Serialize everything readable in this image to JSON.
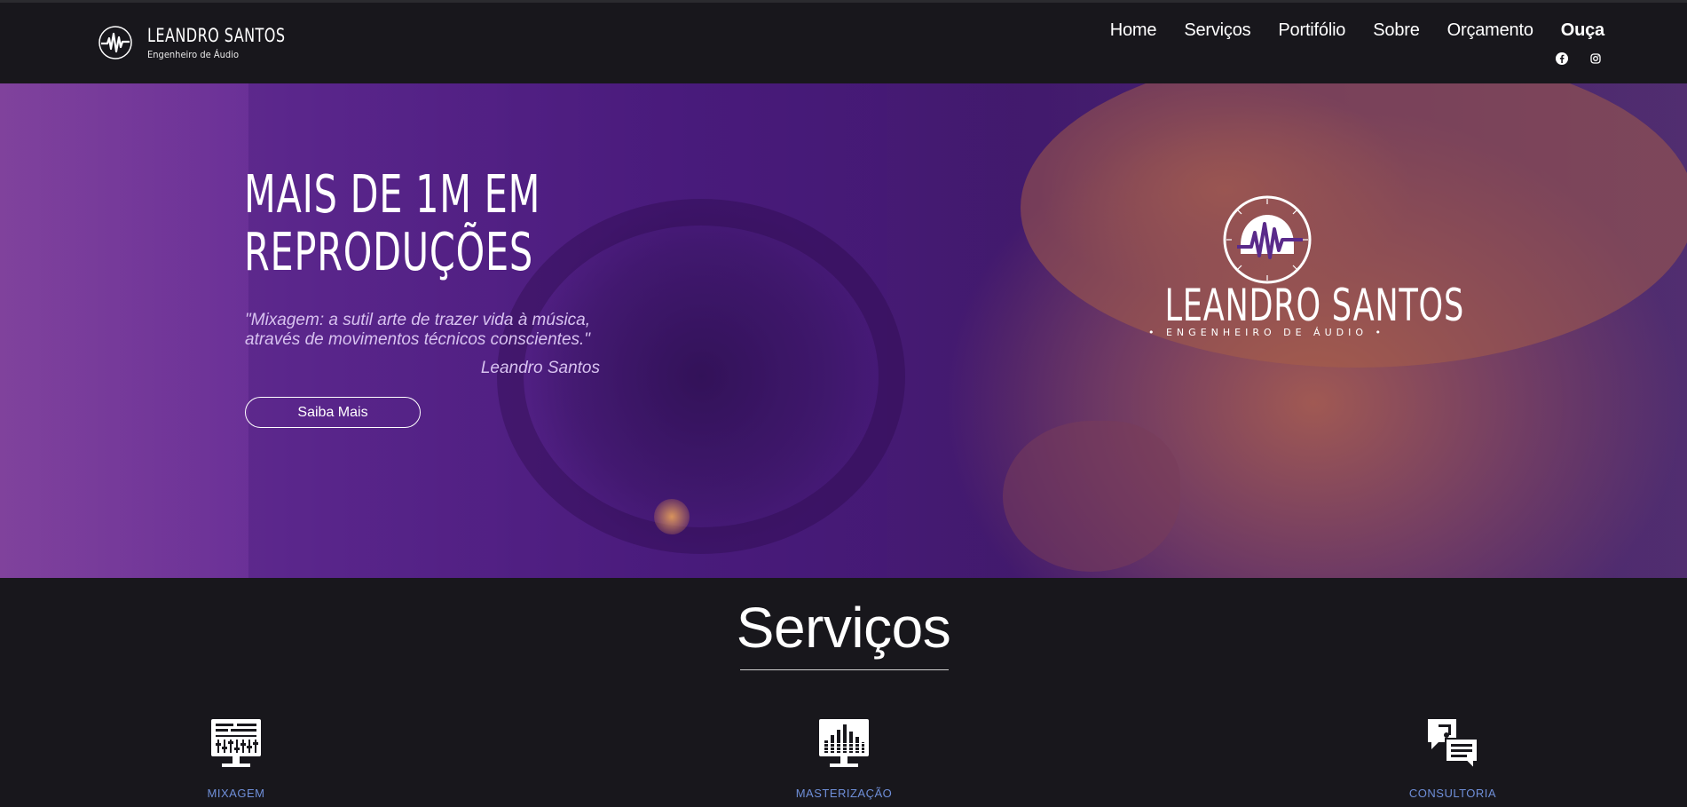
{
  "brand": {
    "name": "LEANDRO SANTOS",
    "subtitle": "Engenheiro de Áudio"
  },
  "nav": {
    "items": [
      {
        "label": "Home"
      },
      {
        "label": "Serviços"
      },
      {
        "label": "Portifólio"
      },
      {
        "label": "Sobre"
      },
      {
        "label": "Orçamento"
      },
      {
        "label": "Ouça"
      }
    ],
    "active": "Ouça"
  },
  "social": {
    "icons": [
      "facebook-icon",
      "instagram-icon"
    ]
  },
  "hero": {
    "headline_line1": "MAIS DE 1M EM",
    "headline_line2": "REPRODUÇÕES",
    "quote_line1": "\"Mixagem: a sutil arte de trazer vida à música,",
    "quote_line2": "através de movimentos técnicos conscientes.\"",
    "quote_author": "Leandro Santos",
    "button_label": "Saiba Mais",
    "logo_name": "LEANDRO SANTOS",
    "logo_sub": "• ENGENHEIRO DE ÁUDIO •"
  },
  "services": {
    "title": "Serviços",
    "items": [
      {
        "label": "MIXAGEM",
        "icon": "mixing-console-icon"
      },
      {
        "label": "MASTERIZAÇÃO",
        "icon": "equalizer-monitor-icon"
      },
      {
        "label": "CONSULTORIA",
        "icon": "chat-music-icon"
      }
    ]
  },
  "colors": {
    "background": "#18171c",
    "accent_purple": "#6b2fa0",
    "service_label": "#6f8fd9"
  }
}
